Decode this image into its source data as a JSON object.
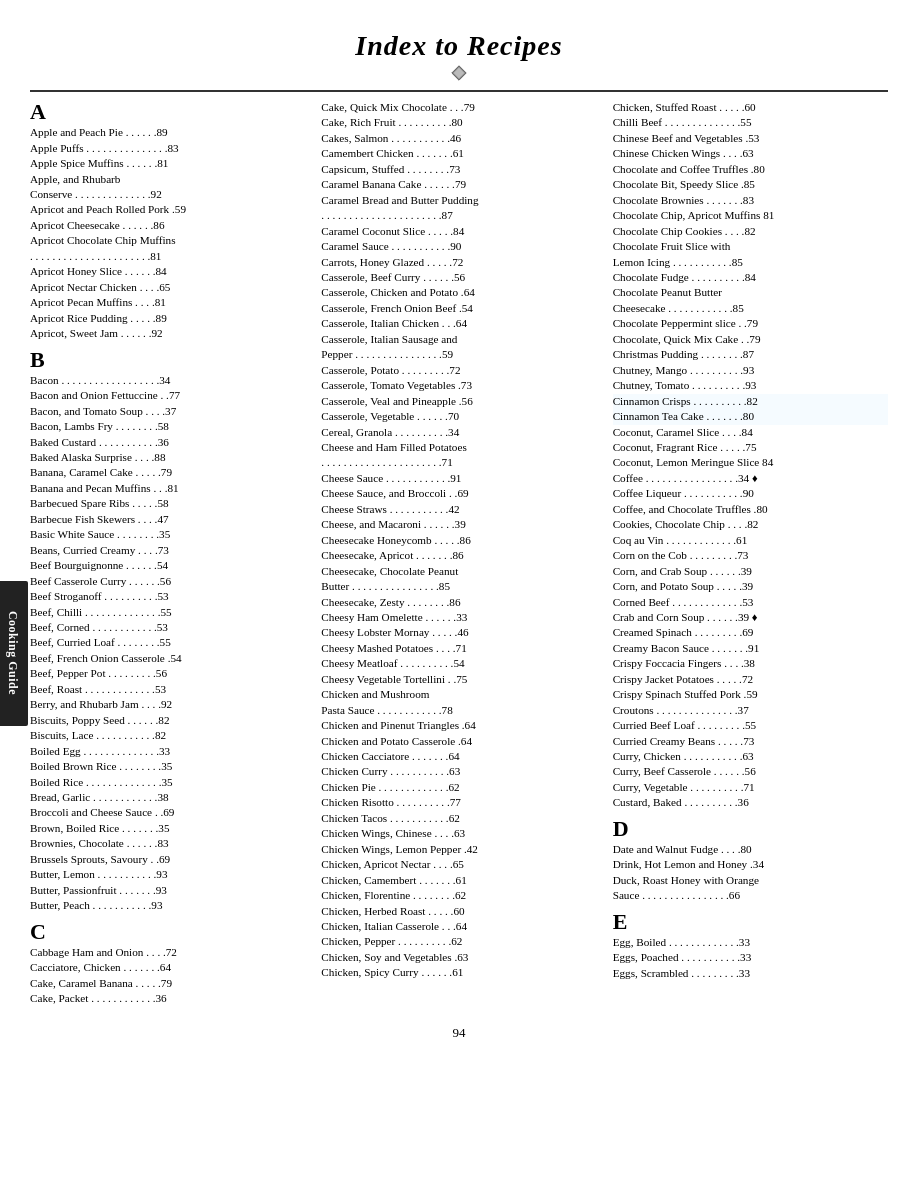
{
  "header": {
    "title": "Index to Recipes"
  },
  "sidebar": {
    "label": "Cooking Guide"
  },
  "page_number": "94",
  "columns": [
    {
      "id": "col1",
      "entries": [
        {
          "letter": "A",
          "big": true
        },
        {
          "text": "Apple and Peach Pie . . . . . .89"
        },
        {
          "text": "Apple Puffs . . . . . . . . . . . . . . .83"
        },
        {
          "text": "Apple Spice Muffins  . . . . . .81"
        },
        {
          "text": "Apple, and Rhubarb"
        },
        {
          "text": "  Conserve . . . . . . . . . . . . . .92"
        },
        {
          "text": "Apricot and Peach Rolled Pork .59"
        },
        {
          "text": "Apricot Cheesecake  . . . . . .86"
        },
        {
          "text": "Apricot Chocolate Chip Muffins"
        },
        {
          "text": " . . . . . . . . . . . . . . . . . . . . . .81"
        },
        {
          "text": "Apricot Honey Slice  . . . . . .84"
        },
        {
          "text": "Apricot Nectar Chicken . . . .65"
        },
        {
          "text": "Apricot Pecan Muffins  . . . .81"
        },
        {
          "text": "Apricot Rice Pudding  . . . . .89"
        },
        {
          "text": "Apricot, Sweet Jam  . . . . . .92"
        },
        {
          "gap": true
        },
        {
          "letter": "B",
          "big": true
        },
        {
          "text": "Bacon . . . . . . . . . . . . . . . . . .34"
        },
        {
          "text": "Bacon and Onion Fettuccine . .77"
        },
        {
          "text": "Bacon, and Tomato Soup . . . .37"
        },
        {
          "text": "Bacon, Lambs Fry  . . . . . . . .58"
        },
        {
          "text": "Baked Custard  . . . . . . . . . . .36"
        },
        {
          "text": "Baked Alaska Surprise  . . . .88"
        },
        {
          "text": "Banana, Caramel Cake . . . . .79"
        },
        {
          "text": "Banana and Pecan Muffins . . .81"
        },
        {
          "text": "Barbecued Spare Ribs  . . . . .58"
        },
        {
          "text": "Barbecue Fish Skewers  . . . .47"
        },
        {
          "text": "Basic White Sauce  . . . . . . . .35"
        },
        {
          "text": "Beans, Curried Creamy  . . . .73"
        },
        {
          "text": "Beef Bourguignonne  . . . . . .54"
        },
        {
          "text": "Beef Casserole Curry  . . . . . .56"
        },
        {
          "text": "Beef Stroganoff  . . . . . . . . . .53"
        },
        {
          "text": "Beef, Chilli  . . . . . . . . . . . . . .55"
        },
        {
          "text": "Beef, Corned  . . . . . . . . . . . .53"
        },
        {
          "text": "Beef, Curried Loaf  . . . . . . . .55"
        },
        {
          "text": "Beef, French Onion Casserole .54"
        },
        {
          "text": "Beef, Pepper Pot  . . . . . . . . .56"
        },
        {
          "text": "Beef, Roast  . . . . . . . . . . . . .53"
        },
        {
          "text": "Berry, and Rhubarb Jam . . . .92"
        },
        {
          "text": "Biscuits, Poppy Seed  . . . . . .82"
        },
        {
          "text": "Biscuits, Lace  . . . . . . . . . . .82"
        },
        {
          "text": "Boiled Egg  . . . . . . . . . . . . . .33"
        },
        {
          "text": "Boiled Brown Rice  . . . . . . . .35"
        },
        {
          "text": "Boiled Rice  . . . . . . . . . . . . . .35"
        },
        {
          "text": "Bread, Garlic  . . . . . . . . . . . .38"
        },
        {
          "text": "Broccoli and Cheese Sauce . .69"
        },
        {
          "text": "Brown, Boiled Rice  . . . . . . .35"
        },
        {
          "text": "Brownies, Chocolate  . . . . . .83"
        },
        {
          "text": "Brussels Sprouts, Savoury  . .69"
        },
        {
          "text": "Butter, Lemon  . . . . . . . . . . .93"
        },
        {
          "text": "Butter, Passionfruit  . . . . . . .93"
        },
        {
          "text": "Butter, Peach  . . . . . . . . . . .93"
        },
        {
          "gap": true
        },
        {
          "letter": "C",
          "big": true
        },
        {
          "text": "Cabbage Ham and Onion . . . .72"
        },
        {
          "text": "Cacciatore, Chicken  . . . . . . .64"
        },
        {
          "text": "Cake, Caramel Banana  . . . . .79"
        },
        {
          "text": "Cake, Packet  . . . . . . . . . . . .36"
        }
      ]
    },
    {
      "id": "col2",
      "entries": [
        {
          "text": "Cake, Quick Mix Chocolate . . .79"
        },
        {
          "text": "Cake, Rich Fruit  . . . . . . . . . .80"
        },
        {
          "text": "Cakes, Salmon  . . . . . . . . . . .46"
        },
        {
          "text": "Camembert Chicken  . . . . . . .61"
        },
        {
          "text": "Capsicum, Stuffed  . . . . . . . .73"
        },
        {
          "text": "Caramel Banana Cake  . . . . . .79"
        },
        {
          "text": "Caramel Bread and Butter Pudding"
        },
        {
          "text": " . . . . . . . . . . . . . . . . . . . . . .87"
        },
        {
          "text": "Caramel Coconut Slice  . . . . .84"
        },
        {
          "text": "Caramel Sauce  . . . . . . . . . . .90"
        },
        {
          "text": "Carrots, Honey Glazed  . . . . .72"
        },
        {
          "text": "Casserole, Beef Curry  . . . . . .56"
        },
        {
          "text": "Casserole, Chicken and Potato .64"
        },
        {
          "text": "Casserole, French Onion Beef .54"
        },
        {
          "text": "Casserole, Italian Chicken  . . .64"
        },
        {
          "text": "Casserole, Italian Sausage and"
        },
        {
          "text": "  Pepper  . . . . . . . . . . . . . . . .59"
        },
        {
          "text": "Casserole, Potato  . . . . . . . . .72"
        },
        {
          "text": "Casserole, Tomato Vegetables .73"
        },
        {
          "text": "Casserole, Veal and Pineapple .56"
        },
        {
          "text": "Casserole, Vegetable  . . . . . .70"
        },
        {
          "text": "Cereal, Granola  . . . . . . . . . .34"
        },
        {
          "text": "Cheese and Ham Filled Potatoes"
        },
        {
          "text": " . . . . . . . . . . . . . . . . . . . . . .71"
        },
        {
          "text": "Cheese Sauce  . . . . . . . . . . . .91"
        },
        {
          "text": "Cheese Sauce, and Broccoli  . .69"
        },
        {
          "text": "Cheese Straws  . . . . . . . . . . .42"
        },
        {
          "text": "Cheese, and Macaroni  . . . . . .39"
        },
        {
          "text": "Cheesecake Honeycomb  . . . . .86"
        },
        {
          "text": "Cheesecake, Apricot  . . . . . . .86"
        },
        {
          "text": "Cheesecake, Chocolate Peanut"
        },
        {
          "text": "  Butter  . . . . . . . . . . . . . . . .85"
        },
        {
          "text": "Cheesecake, Zesty  . . . . . . . .86"
        },
        {
          "text": "Cheesy Ham Omelette  . . . . . .33"
        },
        {
          "text": "Cheesy Lobster Mornay  . . . . .46"
        },
        {
          "text": "Cheesy Mashed Potatoes  . . . .71"
        },
        {
          "text": "Cheesy Meatloaf  . . . . . . . . . .54"
        },
        {
          "text": "Cheesy Vegetable Tortellini  . .75"
        },
        {
          "text": "Chicken and Mushroom"
        },
        {
          "text": "  Pasta Sauce  . . . . . . . . . . . .78"
        },
        {
          "text": "Chicken and Pinenut Triangles .64"
        },
        {
          "text": "Chicken and Potato Casserole .64"
        },
        {
          "text": "Chicken Cacciatore  . . . . . . .64"
        },
        {
          "text": "Chicken Curry  . . . . . . . . . . .63"
        },
        {
          "text": "Chicken Pie  . . . . . . . . . . . . .62"
        },
        {
          "text": "Chicken Risotto  . . . . . . . . . .77"
        },
        {
          "text": "Chicken Tacos  . . . . . . . . . . .62"
        },
        {
          "text": "Chicken Wings, Chinese  . . . .63"
        },
        {
          "text": "Chicken Wings, Lemon Pepper .42"
        },
        {
          "text": "Chicken, Apricot Nectar  . . . .65"
        },
        {
          "text": "Chicken, Camembert  . . . . . . .61"
        },
        {
          "text": "Chicken, Florentine  . . . . . . . .62"
        },
        {
          "text": "Chicken, Herbed Roast  . . . . .60"
        },
        {
          "text": "Chicken, Italian Casserole  . . .64"
        },
        {
          "text": "Chicken, Pepper  . . . . . . . . . .62"
        },
        {
          "text": "Chicken, Soy and Vegetables  .63"
        },
        {
          "text": "Chicken, Spicy Curry  . . . . . .61"
        }
      ]
    },
    {
      "id": "col3",
      "entries": [
        {
          "text": "Chicken, Stuffed Roast  . . . . .60"
        },
        {
          "text": "Chilli Beef  . . . . . . . . . . . . . .55"
        },
        {
          "text": "Chinese Beef and Vegetables .53"
        },
        {
          "text": "Chinese Chicken Wings  . . . .63"
        },
        {
          "text": "Chocolate and Coffee Truffles .80"
        },
        {
          "text": "Chocolate Bit, Speedy Slice  .85"
        },
        {
          "text": "Chocolate Brownies  . . . . . . .83"
        },
        {
          "text": "Chocolate Chip, Apricot Muffins 81"
        },
        {
          "text": "Chocolate Chip Cookies  . . . .82"
        },
        {
          "text": "Chocolate Fruit Slice with"
        },
        {
          "text": "  Lemon Icing  . . . . . . . . . . .85"
        },
        {
          "text": "Chocolate Fudge  . . . . . . . . . .84"
        },
        {
          "text": "Chocolate Peanut Butter"
        },
        {
          "text": "  Cheesecake  . . . . . . . . . . . .85"
        },
        {
          "text": "Chocolate Peppermint slice  . .79"
        },
        {
          "text": "Chocolate, Quick Mix Cake  . .79"
        },
        {
          "text": "Christmas Pudding  . . . . . . . .87"
        },
        {
          "text": "Chutney, Mango  . . . . . . . . . .93"
        },
        {
          "text": "Chutney, Tomato  . . . . . . . . . .93"
        },
        {
          "text": "Cinnamon Crisps  . . . . . . . . . .82",
          "highlight": true
        },
        {
          "text": "Cinnamon Tea Cake  . . . . . . .80",
          "highlight": true
        },
        {
          "text": "Coconut, Caramel Slice  . . . .84"
        },
        {
          "text": "Coconut, Fragrant Rice  . . . . .75"
        },
        {
          "text": "Coconut, Lemon Meringue Slice 84"
        },
        {
          "text": "Coffee  . . . . . . . . . . . . . . . . .34 ♦"
        },
        {
          "text": "Coffee Liqueur  . . . . . . . . . . .90"
        },
        {
          "text": "Coffee, and Chocolate Truffles .80"
        },
        {
          "text": "Cookies, Chocolate Chip  . . . .82"
        },
        {
          "text": "Coq au Vin  . . . . . . . . . . . . .61"
        },
        {
          "text": "Corn on the Cob  . . . . . . . . .73"
        },
        {
          "text": "Corn, and Crab Soup  . . . . . .39"
        },
        {
          "text": "Corn, and Potato Soup  . . . . .39"
        },
        {
          "text": "Corned Beef  . . . . . . . . . . . . .53"
        },
        {
          "text": "Crab and Corn Soup  . . . . . .39 ♦"
        },
        {
          "text": "Creamed Spinach  . . . . . . . . .69"
        },
        {
          "text": "Creamy Bacon Sauce  . . . . . . .91"
        },
        {
          "text": "Crispy Foccacia Fingers  . . . .38"
        },
        {
          "text": "Crispy Jacket Potatoes  . . . . .72"
        },
        {
          "text": "Crispy Spinach Stuffed Pork  .59"
        },
        {
          "text": "Croutons  . . . . . . . . . . . . . . .37"
        },
        {
          "text": "Curried Beef Loaf  . . . . . . . . .55"
        },
        {
          "text": "Curried Creamy Beans  . . . . .73"
        },
        {
          "text": "Curry, Chicken  . . . . . . . . . . .63"
        },
        {
          "text": "Curry, Beef Casserole  . . . . . .56"
        },
        {
          "text": "Curry, Vegetable  . . . . . . . . . .71"
        },
        {
          "text": "Custard, Baked  . . . . . . . . . .36"
        },
        {
          "gap": true
        },
        {
          "letter": "D",
          "big": true
        },
        {
          "text": "Date and Walnut Fudge  . . . .80"
        },
        {
          "text": "Drink, Hot Lemon and Honey  .34"
        },
        {
          "text": "Duck, Roast Honey with Orange"
        },
        {
          "text": "  Sauce  . . . . . . . . . . . . . . . .66"
        },
        {
          "gap": true
        },
        {
          "letter": "E",
          "big": true
        },
        {
          "text": "Egg, Boiled  . . . . . . . . . . . . .33"
        },
        {
          "text": "Eggs, Poached  . . . . . . . . . . .33"
        },
        {
          "text": "Eggs, Scrambled  . . . . . . . . .33"
        }
      ]
    }
  ]
}
